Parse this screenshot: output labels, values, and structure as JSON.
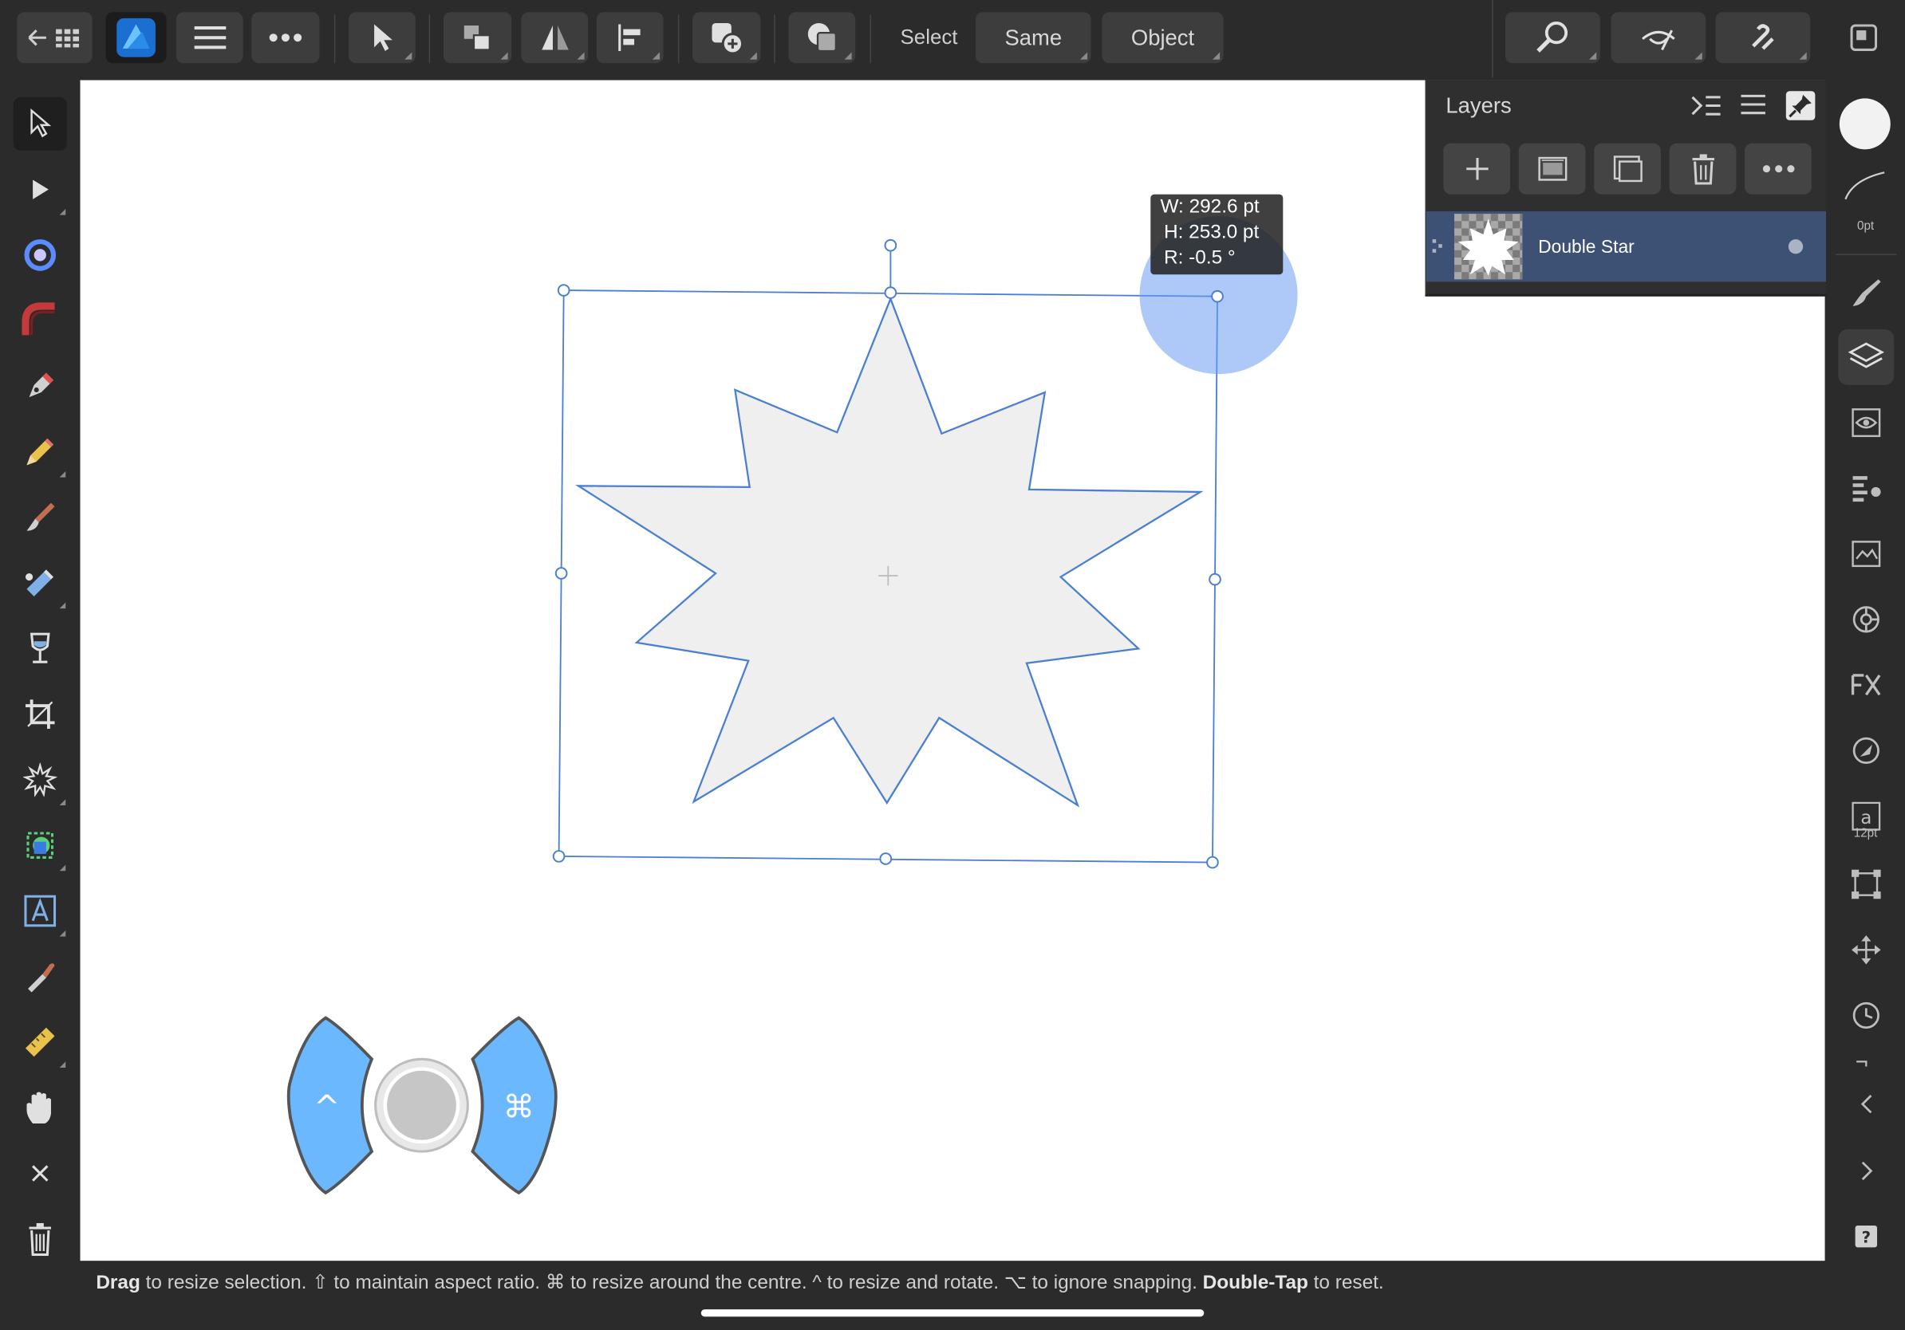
{
  "toolbar": {
    "select_label": "Select",
    "same_label": "Same",
    "object_label": "Object"
  },
  "layers_panel": {
    "title": "Layers",
    "layers": [
      {
        "name": "Double Star"
      }
    ]
  },
  "transform_readout": {
    "width": "W: 292.6 pt",
    "height": "H: 253.0 pt",
    "rotation": "R: -0.5 °"
  },
  "studio": {
    "stroke_width": "0pt",
    "font_size": "12pt"
  },
  "modifier_controller": {
    "left_symbol": "^",
    "right_symbol": "⌘"
  },
  "status": {
    "drag": "Drag",
    "part1": " to resize selection. ⇧ to maintain aspect ratio. ⌘ to resize around the centre. ^ to resize and rotate. ⌥ to ignore snapping. ",
    "double_tap": "Double-Tap",
    "part2": " to reset."
  },
  "colors": {
    "accent": "#2f9bff",
    "selection": "#4a7fd1",
    "shape_fill": "#efefef",
    "layer_selected": "#3d5174",
    "controller_blue": "#6bb8ff"
  }
}
